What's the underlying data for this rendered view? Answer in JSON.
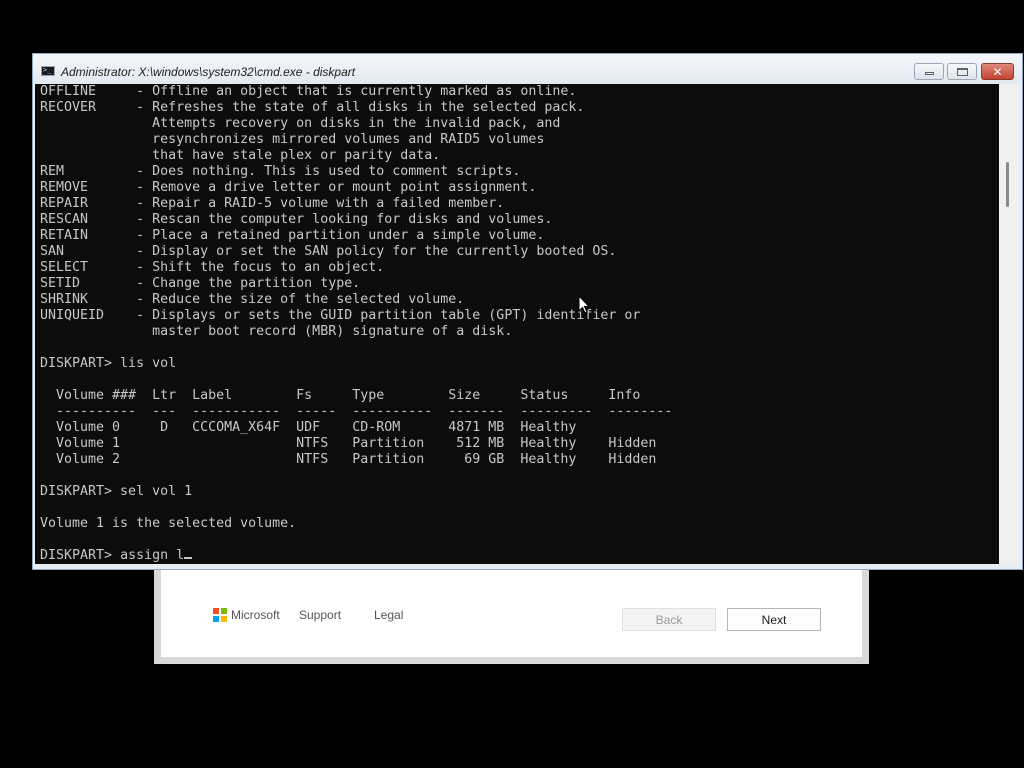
{
  "setup_dialog": {
    "brand": "Microsoft",
    "brand_colors": [
      "#f25022",
      "#7fba00",
      "#00a4ef",
      "#ffb900"
    ],
    "links": {
      "support": "Support",
      "legal": "Legal"
    },
    "buttons": {
      "back": "Back",
      "next": "Next"
    }
  },
  "cmd_window": {
    "title": "Administrator: X:\\windows\\system32\\cmd.exe - diskpart",
    "icon": "console-icon",
    "controls": [
      "minimize-icon",
      "maximize-icon",
      "close-icon"
    ],
    "console_lines": [
      "OFFLINE     - Offline an object that is currently marked as online.",
      "RECOVER     - Refreshes the state of all disks in the selected pack.",
      "              Attempts recovery on disks in the invalid pack, and",
      "              resynchronizes mirrored volumes and RAID5 volumes",
      "              that have stale plex or parity data.",
      "REM         - Does nothing. This is used to comment scripts.",
      "REMOVE      - Remove a drive letter or mount point assignment.",
      "REPAIR      - Repair a RAID-5 volume with a failed member.",
      "RESCAN      - Rescan the computer looking for disks and volumes.",
      "RETAIN      - Place a retained partition under a simple volume.",
      "SAN         - Display or set the SAN policy for the currently booted OS.",
      "SELECT      - Shift the focus to an object.",
      "SETID       - Change the partition type.",
      "SHRINK      - Reduce the size of the selected volume.",
      "UNIQUEID    - Displays or sets the GUID partition table (GPT) identifier or",
      "              master boot record (MBR) signature of a disk.",
      "",
      "DISKPART> lis vol",
      "",
      "  Volume ###  Ltr  Label        Fs     Type        Size     Status     Info",
      "  ----------  ---  -----------  -----  ----------  -------  ---------  --------",
      "  Volume 0     D   CCCOMA_X64F  UDF    CD-ROM      4871 MB  Healthy",
      "  Volume 1                      NTFS   Partition    512 MB  Healthy    Hidden",
      "  Volume 2                      NTFS   Partition     69 GB  Healthy    Hidden",
      "",
      "DISKPART> sel vol 1",
      "",
      "Volume 1 is the selected volume.",
      ""
    ],
    "current_prompt": "DISKPART> ",
    "current_input": "assign l"
  }
}
